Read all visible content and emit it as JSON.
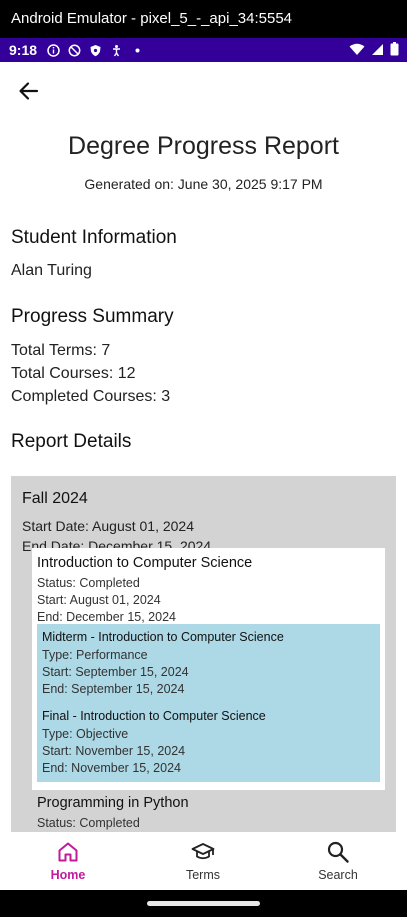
{
  "window": {
    "title": "Android Emulator - pixel_5_-_api_34:5554"
  },
  "status_bar": {
    "time": "9:18"
  },
  "header": {
    "title": "Degree Progress Report",
    "generated": "Generated on: June 30, 2025 9:17 PM"
  },
  "student": {
    "heading": "Student Information",
    "name": "Alan Turing"
  },
  "summary": {
    "heading": "Progress Summary",
    "total_terms": "Total Terms: 7",
    "total_courses": "Total Courses: 12",
    "completed_courses": "Completed Courses: 3"
  },
  "details": {
    "heading": "Report Details",
    "term": {
      "name": "Fall 2024",
      "start": "Start Date: August 01, 2024",
      "end": "End Date: December 15, 2024",
      "courses": [
        {
          "title": "Introduction to Computer Science",
          "status": "Status: Completed",
          "start": "Start: August 01, 2024",
          "end": "End: December 15, 2024",
          "assessments": [
            {
              "title": "Midterm - Introduction to Computer Science",
              "type": "Type: Performance",
              "start": "Start: September 15, 2024",
              "end": "End: September 15, 2024"
            },
            {
              "title": "Final - Introduction to Computer Science",
              "type": "Type: Objective",
              "start": "Start: November 15, 2024",
              "end": "End: November 15, 2024"
            }
          ]
        },
        {
          "title": "Programming in Python",
          "status": "Status: Completed"
        }
      ]
    }
  },
  "bottom_nav": {
    "items": [
      {
        "label": "Home",
        "icon": "home-icon",
        "active": true
      },
      {
        "label": "Terms",
        "icon": "graduation-cap-icon"
      },
      {
        "label": "Search",
        "icon": "search-icon"
      }
    ]
  },
  "colors": {
    "status_bar": "#33009a",
    "active_nav": "#c21a9a",
    "term_box": "#d3d3d3",
    "assessment_box": "#add8e6"
  }
}
